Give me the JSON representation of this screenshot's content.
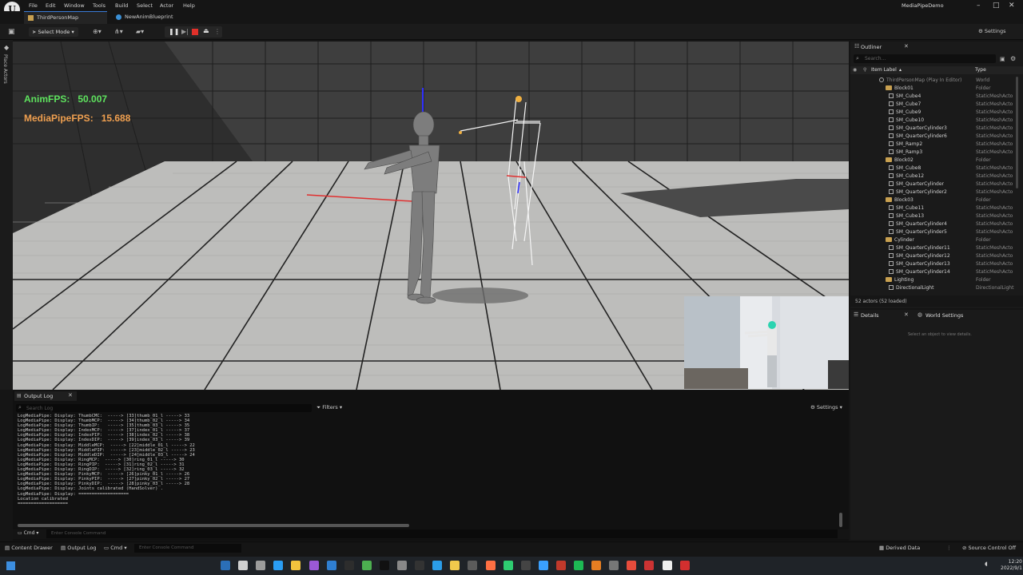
{
  "app": {
    "menu": [
      "File",
      "Edit",
      "Window",
      "Tools",
      "Build",
      "Select",
      "Actor",
      "Help"
    ],
    "project": "MediaPipeDemo",
    "tabs": [
      "ThirdPersonMap",
      "NewAnimBlueprint"
    ]
  },
  "toolbar": {
    "select_mode": "Select Mode",
    "settings": "Settings"
  },
  "sidebar": {
    "place_actors": "Place Actors"
  },
  "viewport": {
    "anim_fps_label": "AnimFPS:",
    "anim_fps_value": "50.007",
    "mediapipe_fps_label": "MediaPipeFPS:",
    "mediapipe_fps_value": "15.688"
  },
  "outliner": {
    "title": "Outliner",
    "search_placeholder": "Search...",
    "col_label": "Item Label",
    "col_type": "Type",
    "rows": [
      {
        "label": "ThirdPersonMap (Play In Editor)",
        "type": "World",
        "kind": "world",
        "depth": 0
      },
      {
        "label": "Block01",
        "type": "Folder",
        "kind": "folder",
        "depth": 1
      },
      {
        "label": "SM_Cube4",
        "type": "StaticMeshActo",
        "kind": "mesh",
        "depth": 2
      },
      {
        "label": "SM_Cube7",
        "type": "StaticMeshActo",
        "kind": "mesh",
        "depth": 2
      },
      {
        "label": "SM_Cube9",
        "type": "StaticMeshActo",
        "kind": "mesh",
        "depth": 2
      },
      {
        "label": "SM_Cube10",
        "type": "StaticMeshActo",
        "kind": "mesh",
        "depth": 2
      },
      {
        "label": "SM_QuarterCylinder3",
        "type": "StaticMeshActo",
        "kind": "mesh",
        "depth": 2
      },
      {
        "label": "SM_QuarterCylinder6",
        "type": "StaticMeshActo",
        "kind": "mesh",
        "depth": 2
      },
      {
        "label": "SM_Ramp2",
        "type": "StaticMeshActo",
        "kind": "mesh",
        "depth": 2
      },
      {
        "label": "SM_Ramp3",
        "type": "StaticMeshActo",
        "kind": "mesh",
        "depth": 2
      },
      {
        "label": "Block02",
        "type": "Folder",
        "kind": "folder",
        "depth": 1
      },
      {
        "label": "SM_Cube8",
        "type": "StaticMeshActo",
        "kind": "mesh",
        "depth": 2
      },
      {
        "label": "SM_Cube12",
        "type": "StaticMeshActo",
        "kind": "mesh",
        "depth": 2
      },
      {
        "label": "SM_QuarterCylinder",
        "type": "StaticMeshActo",
        "kind": "mesh",
        "depth": 2
      },
      {
        "label": "SM_QuarterCylinder2",
        "type": "StaticMeshActo",
        "kind": "mesh",
        "depth": 2
      },
      {
        "label": "Block03",
        "type": "Folder",
        "kind": "folder",
        "depth": 1
      },
      {
        "label": "SM_Cube11",
        "type": "StaticMeshActo",
        "kind": "mesh",
        "depth": 2
      },
      {
        "label": "SM_Cube13",
        "type": "StaticMeshActo",
        "kind": "mesh",
        "depth": 2
      },
      {
        "label": "SM_QuarterCylinder4",
        "type": "StaticMeshActo",
        "kind": "mesh",
        "depth": 2
      },
      {
        "label": "SM_QuarterCylinder5",
        "type": "StaticMeshActo",
        "kind": "mesh",
        "depth": 2
      },
      {
        "label": "Cylinder",
        "type": "Folder",
        "kind": "folder",
        "depth": 1
      },
      {
        "label": "SM_QuarterCylinder11",
        "type": "StaticMeshActo",
        "kind": "mesh",
        "depth": 2
      },
      {
        "label": "SM_QuarterCylinder12",
        "type": "StaticMeshActo",
        "kind": "mesh",
        "depth": 2
      },
      {
        "label": "SM_QuarterCylinder13",
        "type": "StaticMeshActo",
        "kind": "mesh",
        "depth": 2
      },
      {
        "label": "SM_QuarterCylinder14",
        "type": "StaticMeshActo",
        "kind": "mesh",
        "depth": 2
      },
      {
        "label": "Lighting",
        "type": "Folder",
        "kind": "folder",
        "depth": 1
      },
      {
        "label": "DirectionalLight",
        "type": "DirectionalLight",
        "kind": "mesh",
        "depth": 2
      }
    ],
    "actor_count": "52 actors (52 loaded)"
  },
  "details": {
    "tab": "Details",
    "world_settings": "World Settings",
    "empty": "Select an object to view details."
  },
  "output_log": {
    "tab": "Output Log",
    "search_placeholder": "Search Log",
    "filters": "Filters",
    "settings": "Settings",
    "lines": [
      "LogMediaPipe: Display: ThumbCMC:  -----> [33]thumb_01_l -----> 33",
      "LogMediaPipe: Display: ThumbMCP:  -----> [34]thumb_02_l -----> 34",
      "LogMediaPipe: Display: ThumbIP:   -----> [35]thumb_03_l -----> 35",
      "LogMediaPipe: Display: IndexMCP:  -----> [37]index_01_l -----> 37",
      "LogMediaPipe: Display: IndexPIP:  -----> [38]index_02_l -----> 38",
      "LogMediaPipe: Display: IndexDIP:  -----> [39]index_03_l -----> 39",
      "LogMediaPipe: Display: MiddleMCP:  -----> [22]middle_01_l -----> 22",
      "LogMediaPipe: Display: MiddlePIP:  -----> [23]middle_02_l -----> 23",
      "LogMediaPipe: Display: MiddleDIP:  -----> [24]middle_03_l -----> 24",
      "LogMediaPipe: Display: RingMCP:  -----> [30]ring_01_l -----> 30",
      "LogMediaPipe: Display: RingPIP:  -----> [31]ring_02_l -----> 31",
      "LogMediaPipe: Display: RingDIP:  -----> [32]ring_03_l -----> 32",
      "LogMediaPipe: Display: PinkyMCP:  -----> [26]pinky_01_l -----> 26",
      "LogMediaPipe: Display: PinkyPIP:  -----> [27]pinky_02_l -----> 27",
      "LogMediaPipe: Display: PinkyDIP:  -----> [28]pinky_03_l -----> 28",
      "LogMediaPipe: Display: Joints calibrated (HandSolver) .",
      "LogMediaPipe: Display: ===================",
      "Location calibrated",
      "==================="
    ],
    "cmd": "Cmd",
    "cmd_placeholder": "Enter Console Command"
  },
  "statusbar": {
    "content_drawer": "Content Drawer",
    "output_log": "Output Log",
    "cmd": "Cmd",
    "console_placeholder": "Enter Console Command",
    "derived_data": "Derived Data",
    "source_control": "Source Control Off"
  },
  "taskbar": {
    "time": "12:20",
    "date": "2022/9/1"
  },
  "colors": {
    "anim_fps": "#5ee35e",
    "mediapipe_fps": "#f0a050",
    "accent": "#3a7bd5",
    "folder": "#c8a050"
  }
}
